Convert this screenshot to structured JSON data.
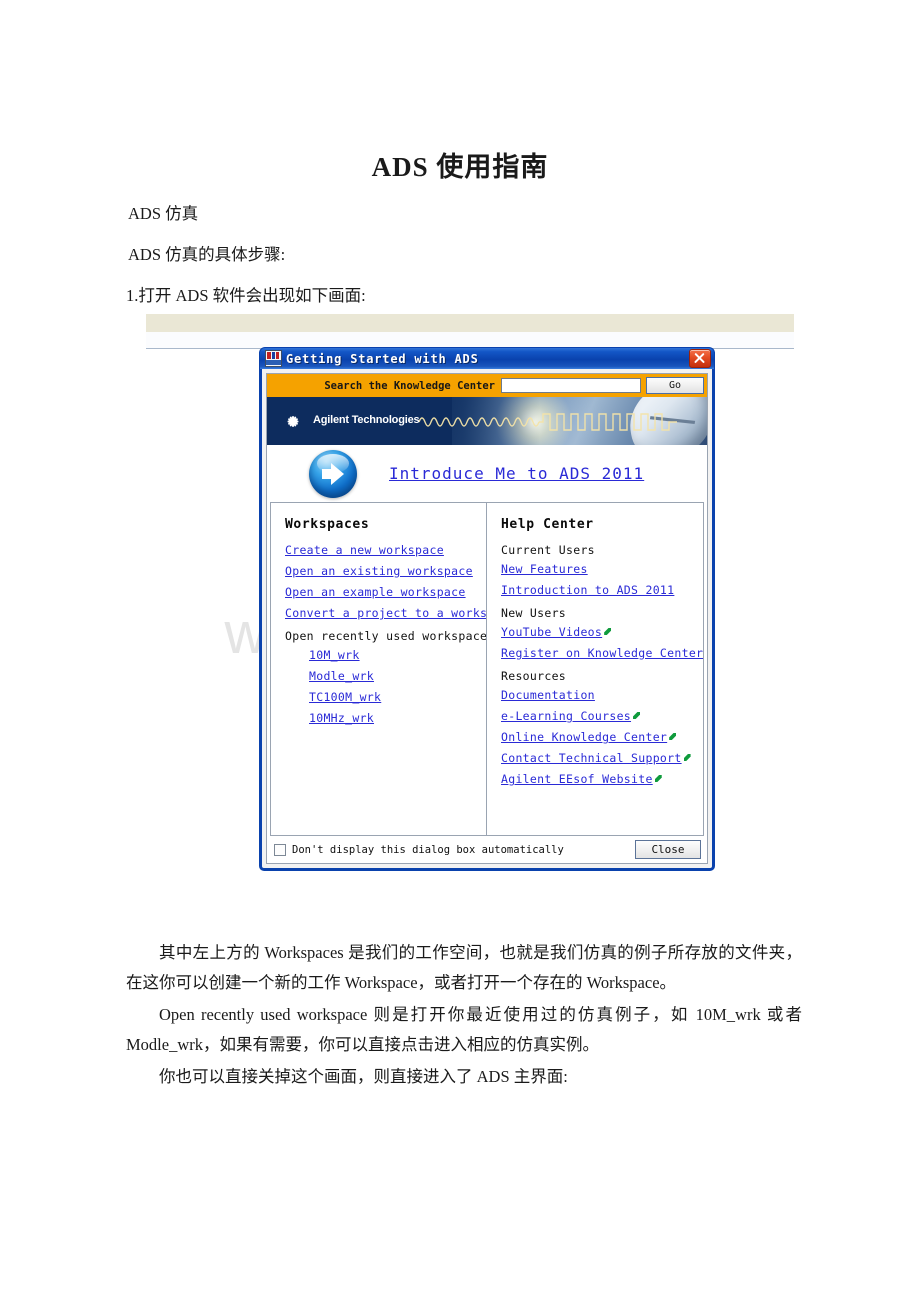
{
  "document": {
    "title": "ADS 使用指南",
    "line1": "ADS 仿真",
    "line2": "ADS 仿真的具体步骤:",
    "line3": "1.打开 ADS 软件会出现如下画面:",
    "para1": "其中左上方的 Workspaces 是我们的工作空间，也就是我们仿真的例子所存放的文件夹，在这你可以创建一个新的工作 Workspace，或者打开一个存在的 Workspace。",
    "para2": "Open recently used workspace 则是打开你最近使用过的仿真例子，如 10M_wrk 或者 Modle_wrk，如果有需要，你可以直接点击进入相应的仿真实例。",
    "para3": "你也可以直接关掉这个画面，则直接进入了 ADS 主界面:",
    "watermark": "www.bdocx.com"
  },
  "dialog": {
    "title": "Getting Started with ADS",
    "title_icon": "ads-app-icon",
    "close_icon": "close-icon",
    "search": {
      "label": "Search the Knowledge Center",
      "value": "",
      "placeholder": "",
      "go_label": "Go"
    },
    "banner": {
      "brand": "Agilent Technologies",
      "logo_icon": "agilent-starburst-icon",
      "graphic": "waveform-to-squarewave-with-satellite-dish"
    },
    "intro": {
      "arrow_icon": "blue-arrow-circle-icon",
      "link_label": "Introduce Me to ADS 2011"
    },
    "workspaces": {
      "heading": "Workspaces",
      "links": [
        "Create a new workspace",
        "Open an existing workspace",
        "Open an example workspace",
        "Convert a project to a workspace"
      ],
      "recent_heading": "Open recently used workspace",
      "recent": [
        "10M_wrk",
        "Modle_wrk",
        "TC100M_wrk",
        "10MHz_wrk"
      ]
    },
    "help_center": {
      "heading": "Help Center",
      "groups": [
        {
          "label": "Current Users",
          "links": [
            {
              "label": "New Features",
              "external": false
            },
            {
              "label": "Introduction to ADS 2011",
              "external": false
            }
          ]
        },
        {
          "label": "New Users",
          "links": [
            {
              "label": "YouTube Videos",
              "external": true
            },
            {
              "label": "Register on Knowledge Center",
              "external": true
            }
          ]
        },
        {
          "label": "Resources",
          "links": [
            {
              "label": "Documentation",
              "external": false
            },
            {
              "label": "e-Learning Courses",
              "external": true
            },
            {
              "label": "Online Knowledge Center",
              "external": true
            },
            {
              "label": "Contact Technical Support",
              "external": true
            },
            {
              "label": "Agilent EEsof Website",
              "external": true
            }
          ]
        }
      ]
    },
    "footer": {
      "checkbox_label": "Don't display this dialog box automatically",
      "checkbox_checked": false,
      "close_label": "Close"
    }
  },
  "colors": {
    "titlebar_blue": "#0a42ad",
    "search_orange": "#f5a200",
    "banner_navy": "#0d2c5e",
    "link_blue": "#2a2ad6",
    "external_green": "#0f9b3c",
    "strip_beige": "#eae7d5",
    "watermark_gray": "#e4e4e4"
  }
}
